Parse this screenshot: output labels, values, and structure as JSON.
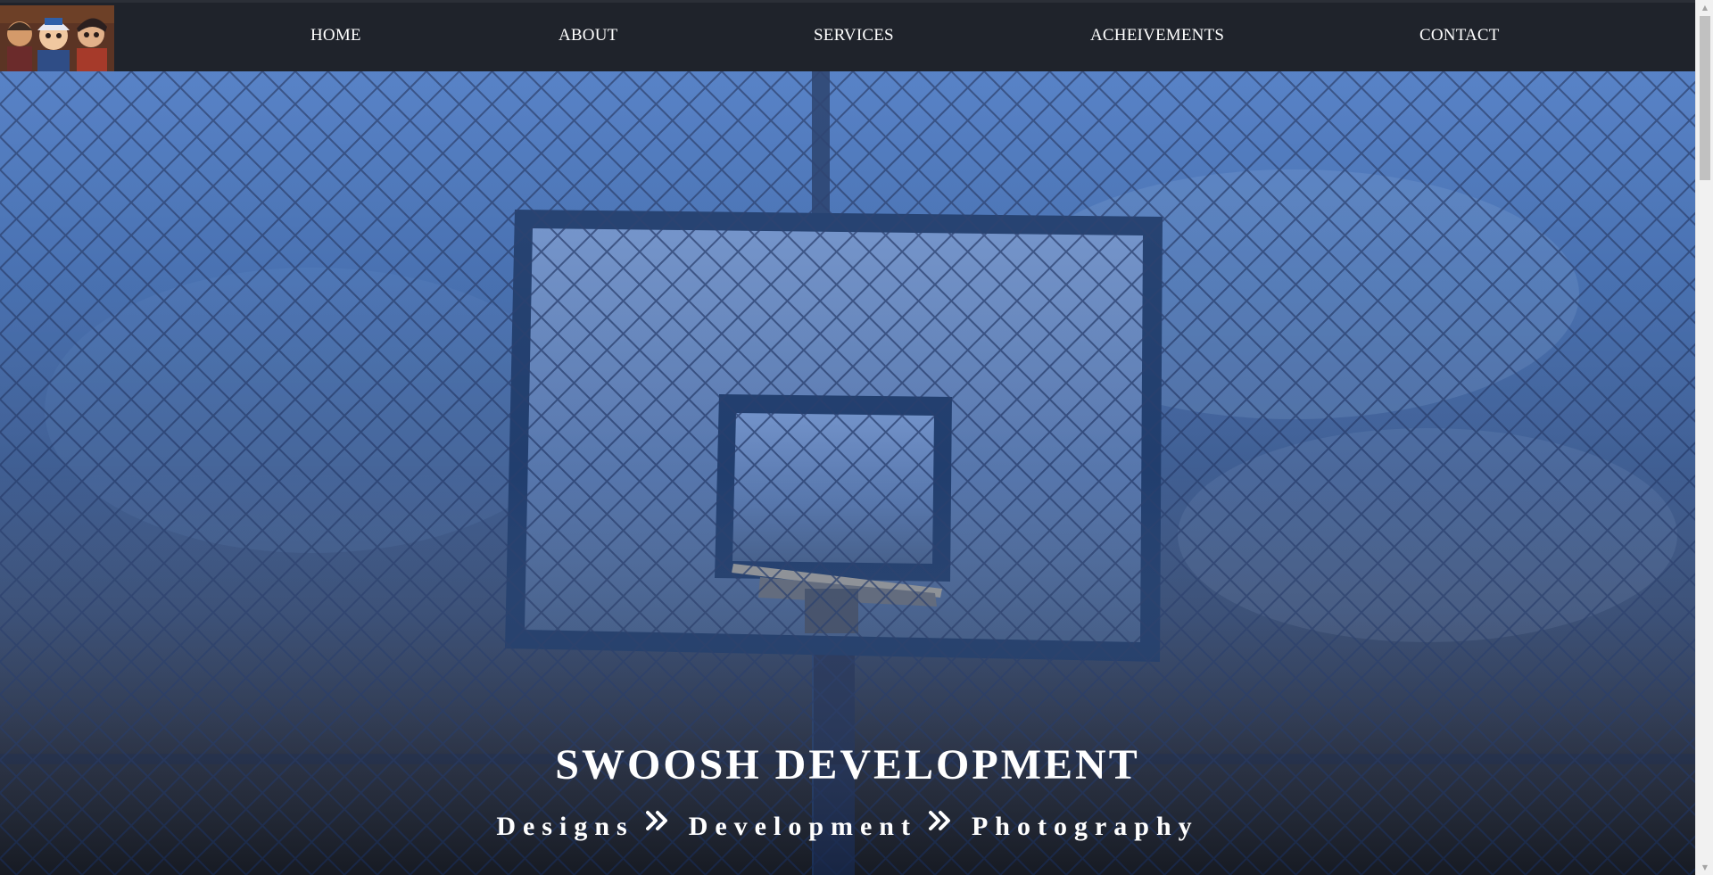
{
  "nav": {
    "logo_icon": "cartoon-characters-logo",
    "items": [
      {
        "label": "HOME"
      },
      {
        "label": "ABOUT"
      },
      {
        "label": "SERVICES"
      },
      {
        "label": "ACHEIVEMENTS"
      },
      {
        "label": "CONTACT"
      }
    ]
  },
  "hero": {
    "title": "SWOOSH DEVELOPMENT",
    "subtitle_items": [
      "Designs",
      "Development",
      "Photography"
    ],
    "separator_icon": "double-chevron-right-icon",
    "background_image": "basketball-backboard-chain-fence",
    "colors": {
      "overlay_top": "#4a78c2",
      "overlay_bottom": "#1e232e",
      "text": "#ffffff"
    }
  },
  "colors": {
    "navbar_bg": "#1f232b",
    "nav_text": "#ffffff"
  }
}
